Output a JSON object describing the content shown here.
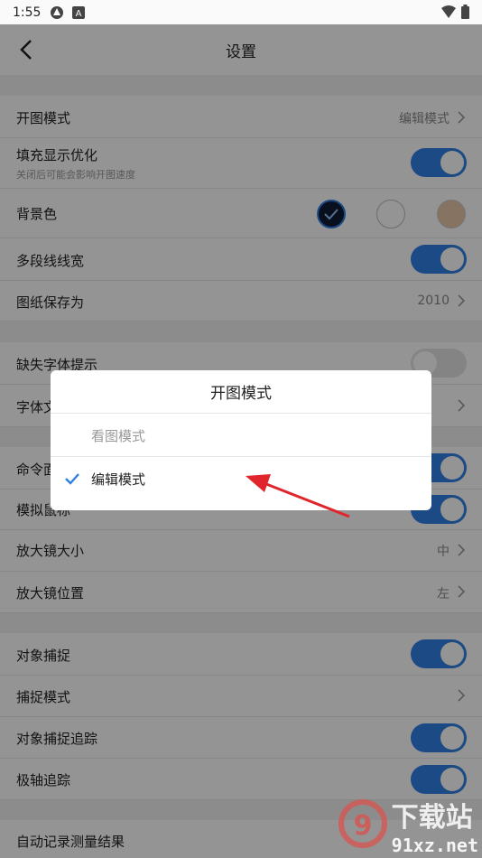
{
  "status_bar": {
    "time": "1:55"
  },
  "app_bar": {
    "title": "设置"
  },
  "settings": {
    "open_mode": {
      "label": "开图模式",
      "value": "编辑模式"
    },
    "fill_opt": {
      "label": "填充显示优化",
      "sub": "关闭后可能会影响开图速度",
      "on": true
    },
    "bg_color": {
      "label": "背景色",
      "colors": [
        "#0f1c36",
        "#ffffff",
        "#e9c6a8"
      ]
    },
    "polyline_width": {
      "label": "多段线线宽",
      "on": true
    },
    "save_as": {
      "label": "图纸保存为",
      "value": "2010"
    },
    "missing_font": {
      "label": "缺失字体提示",
      "on": false
    },
    "font_file": {
      "label": "字体文"
    },
    "command": {
      "label": "命令面",
      "on": true
    },
    "sim_mouse": {
      "label": "模拟鼠标",
      "on": true
    },
    "magnifier_size": {
      "label": "放大镜大小",
      "value": "中"
    },
    "magnifier_pos": {
      "label": "放大镜位置",
      "value": "左"
    },
    "osnap": {
      "label": "对象捕捉",
      "on": true
    },
    "snap_mode": {
      "label": "捕捉模式"
    },
    "osnap_track": {
      "label": "对象捕捉追踪",
      "on": true
    },
    "polar_track": {
      "label": "极轴追踪",
      "on": true
    },
    "auto_record": {
      "label": "自动记录测量结果"
    }
  },
  "dialog": {
    "title": "开图模式",
    "options": [
      {
        "label": "看图模式",
        "selected": false
      },
      {
        "label": "编辑模式",
        "selected": true
      }
    ]
  },
  "watermark": {
    "text": "下载站",
    "url_text": "91xz.net"
  },
  "colors": {
    "accent": "#2f80e4",
    "annotation_arrow": "#e0262c"
  }
}
